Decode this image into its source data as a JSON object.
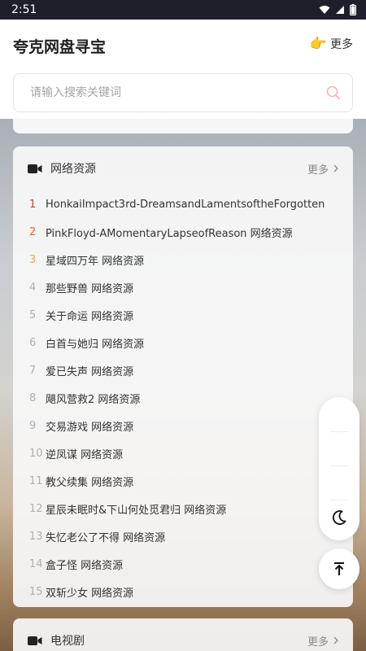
{
  "status_bar": {
    "time": "2:51"
  },
  "header": {
    "title": "夸克网盘寻宝",
    "more_label": "更多"
  },
  "search": {
    "placeholder": "请输入搜索关键词"
  },
  "main_card": {
    "title": "网络资源",
    "more_label": "更多",
    "items": [
      {
        "rank": "1",
        "text": "HonkaiImpact3rd-DreamsandLamentsoftheForgotten"
      },
      {
        "rank": "2",
        "text": "PinkFloyd-AMomentaryLapseofReason 网络资源"
      },
      {
        "rank": "3",
        "text": "星域四万年 网络资源"
      },
      {
        "rank": "4",
        "text": "那些野兽 网络资源"
      },
      {
        "rank": "5",
        "text": "关于命运 网络资源"
      },
      {
        "rank": "6",
        "text": "白首与她归 网络资源"
      },
      {
        "rank": "7",
        "text": "爱已失声 网络资源"
      },
      {
        "rank": "8",
        "text": "飓风营救2 网络资源"
      },
      {
        "rank": "9",
        "text": "交易游戏 网络资源"
      },
      {
        "rank": "10",
        "text": "逆凤谋 网络资源"
      },
      {
        "rank": "11",
        "text": "教父续集 网络资源"
      },
      {
        "rank": "12",
        "text": "星辰未眠时&下山何处觅君归 网络资源"
      },
      {
        "rank": "13",
        "text": "失忆老公了不得 网络资源"
      },
      {
        "rank": "14",
        "text": "盒子怪 网络资源"
      },
      {
        "rank": "15",
        "text": "双斩少女 网络资源"
      }
    ]
  },
  "tv_card": {
    "title": "电视剧",
    "more_label": "更多"
  },
  "colors": {
    "rank1": "#e03a2f",
    "rank2": "#f26522",
    "rank3": "#f2a93b",
    "rank_normal": "#b0b0b0"
  },
  "icons": [
    "wifi-icon",
    "signal-icon",
    "battery-icon",
    "pointing-hand-icon",
    "search-icon",
    "video-camera-icon",
    "chevron-right-icon",
    "moon-icon",
    "back-to-top-icon"
  ]
}
